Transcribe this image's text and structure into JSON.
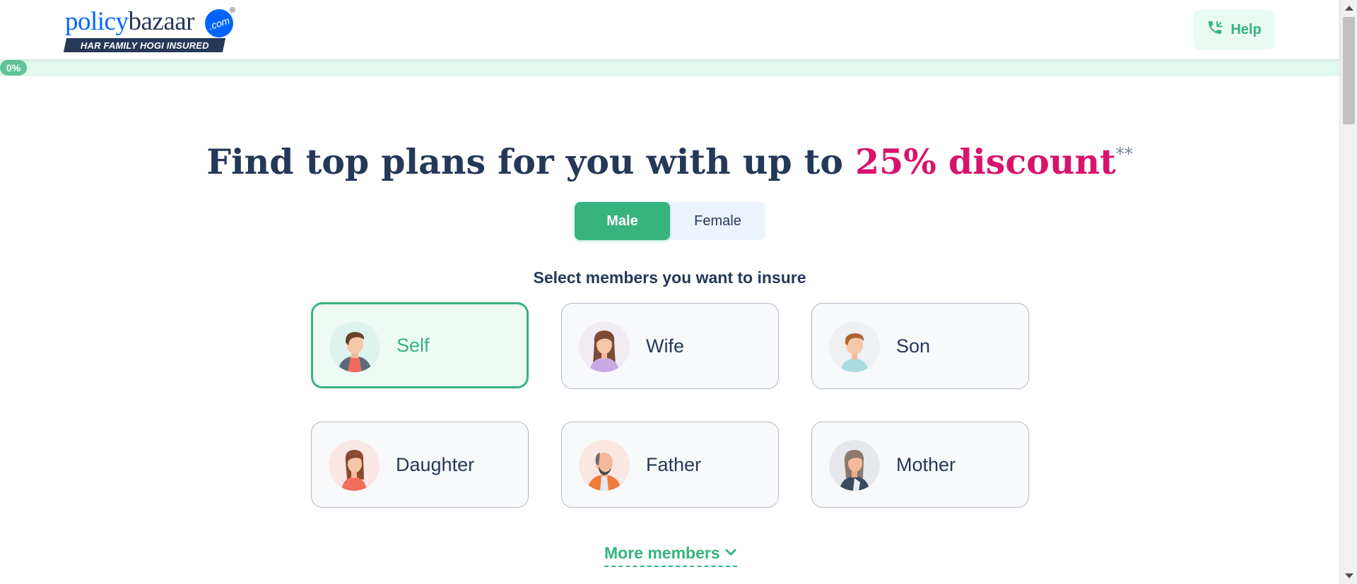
{
  "header": {
    "logo_part1": "policy",
    "logo_part2": "bazaar",
    "logo_com": ".com",
    "logo_reg": "®",
    "tagline": "HAR FAMILY HOGI INSURED",
    "help_label": "Help"
  },
  "progress": {
    "label": "0%",
    "value": 0
  },
  "hero": {
    "title_start": "Find top plans for you with up to ",
    "title_highlight": "25% discount",
    "title_mark": "**"
  },
  "gender": {
    "selected": "Male",
    "options": [
      "Male",
      "Female"
    ]
  },
  "members": {
    "prompt": "Select members you want to insure",
    "items": [
      {
        "label": "Self",
        "selected": true,
        "icon": "self-avatar-icon"
      },
      {
        "label": "Wife",
        "selected": false,
        "icon": "wife-avatar-icon"
      },
      {
        "label": "Son",
        "selected": false,
        "icon": "son-avatar-icon"
      },
      {
        "label": "Daughter",
        "selected": false,
        "icon": "daughter-avatar-icon"
      },
      {
        "label": "Father",
        "selected": false,
        "icon": "father-avatar-icon"
      },
      {
        "label": "Mother",
        "selected": false,
        "icon": "mother-avatar-icon"
      }
    ],
    "more_label": "More members"
  },
  "colors": {
    "brand_blue": "#0065ff",
    "navy": "#253858",
    "accent_green": "#36b37e",
    "discount_pink": "#d8136b",
    "selected_bg": "#eefbf5"
  }
}
